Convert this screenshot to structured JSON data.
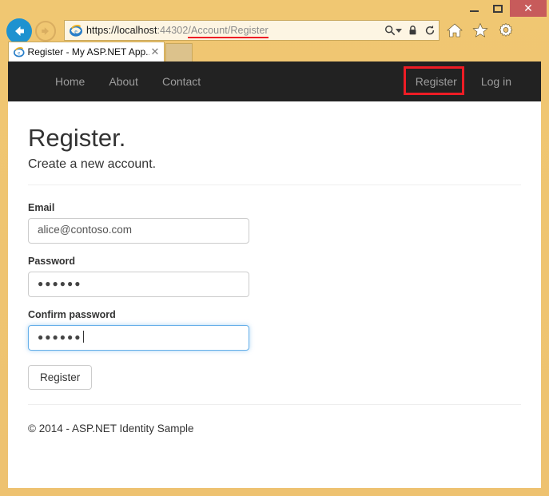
{
  "browser": {
    "window_controls": {
      "minimize": "–",
      "maximize": "□",
      "close": "✕"
    },
    "address": {
      "scheme": "https://",
      "host": "localhost",
      "port": ":44302",
      "path": "/Account/Register",
      "full_url": "https://localhost:44302/Account/Register",
      "highlight_color": "#ee1c25"
    },
    "tab": {
      "title": "Register - My ASP.NET App...",
      "close_label": "✕"
    },
    "icons": {
      "back": "back-arrow-icon",
      "forward": "forward-arrow-icon",
      "favicon": "ie-logo-icon",
      "search": "search-icon",
      "dropdown": "chevron-down-icon",
      "lock": "lock-icon",
      "refresh": "refresh-icon",
      "home": "home-icon",
      "favorites": "star-icon",
      "tools": "gear-icon"
    }
  },
  "site": {
    "nav": {
      "left_links": [
        {
          "label": "Home"
        },
        {
          "label": "About"
        },
        {
          "label": "Contact"
        }
      ],
      "right_links": [
        {
          "label": "Register",
          "highlighted": true
        },
        {
          "label": "Log in",
          "highlighted": false
        }
      ],
      "background_color": "#222222",
      "link_color": "#9d9d9d"
    },
    "page": {
      "title": "Register.",
      "subtitle": "Create a new account."
    },
    "form": {
      "fields": [
        {
          "label": "Email",
          "value": "alice@contoso.com",
          "type": "email",
          "focused": false
        },
        {
          "label": "Password",
          "value": "●●●●●●",
          "type": "password",
          "focused": false
        },
        {
          "label": "Confirm password",
          "value": "●●●●●●",
          "type": "password",
          "focused": true
        }
      ],
      "submit_label": "Register"
    },
    "footer": {
      "text": "© 2014 - ASP.NET Identity Sample"
    }
  }
}
